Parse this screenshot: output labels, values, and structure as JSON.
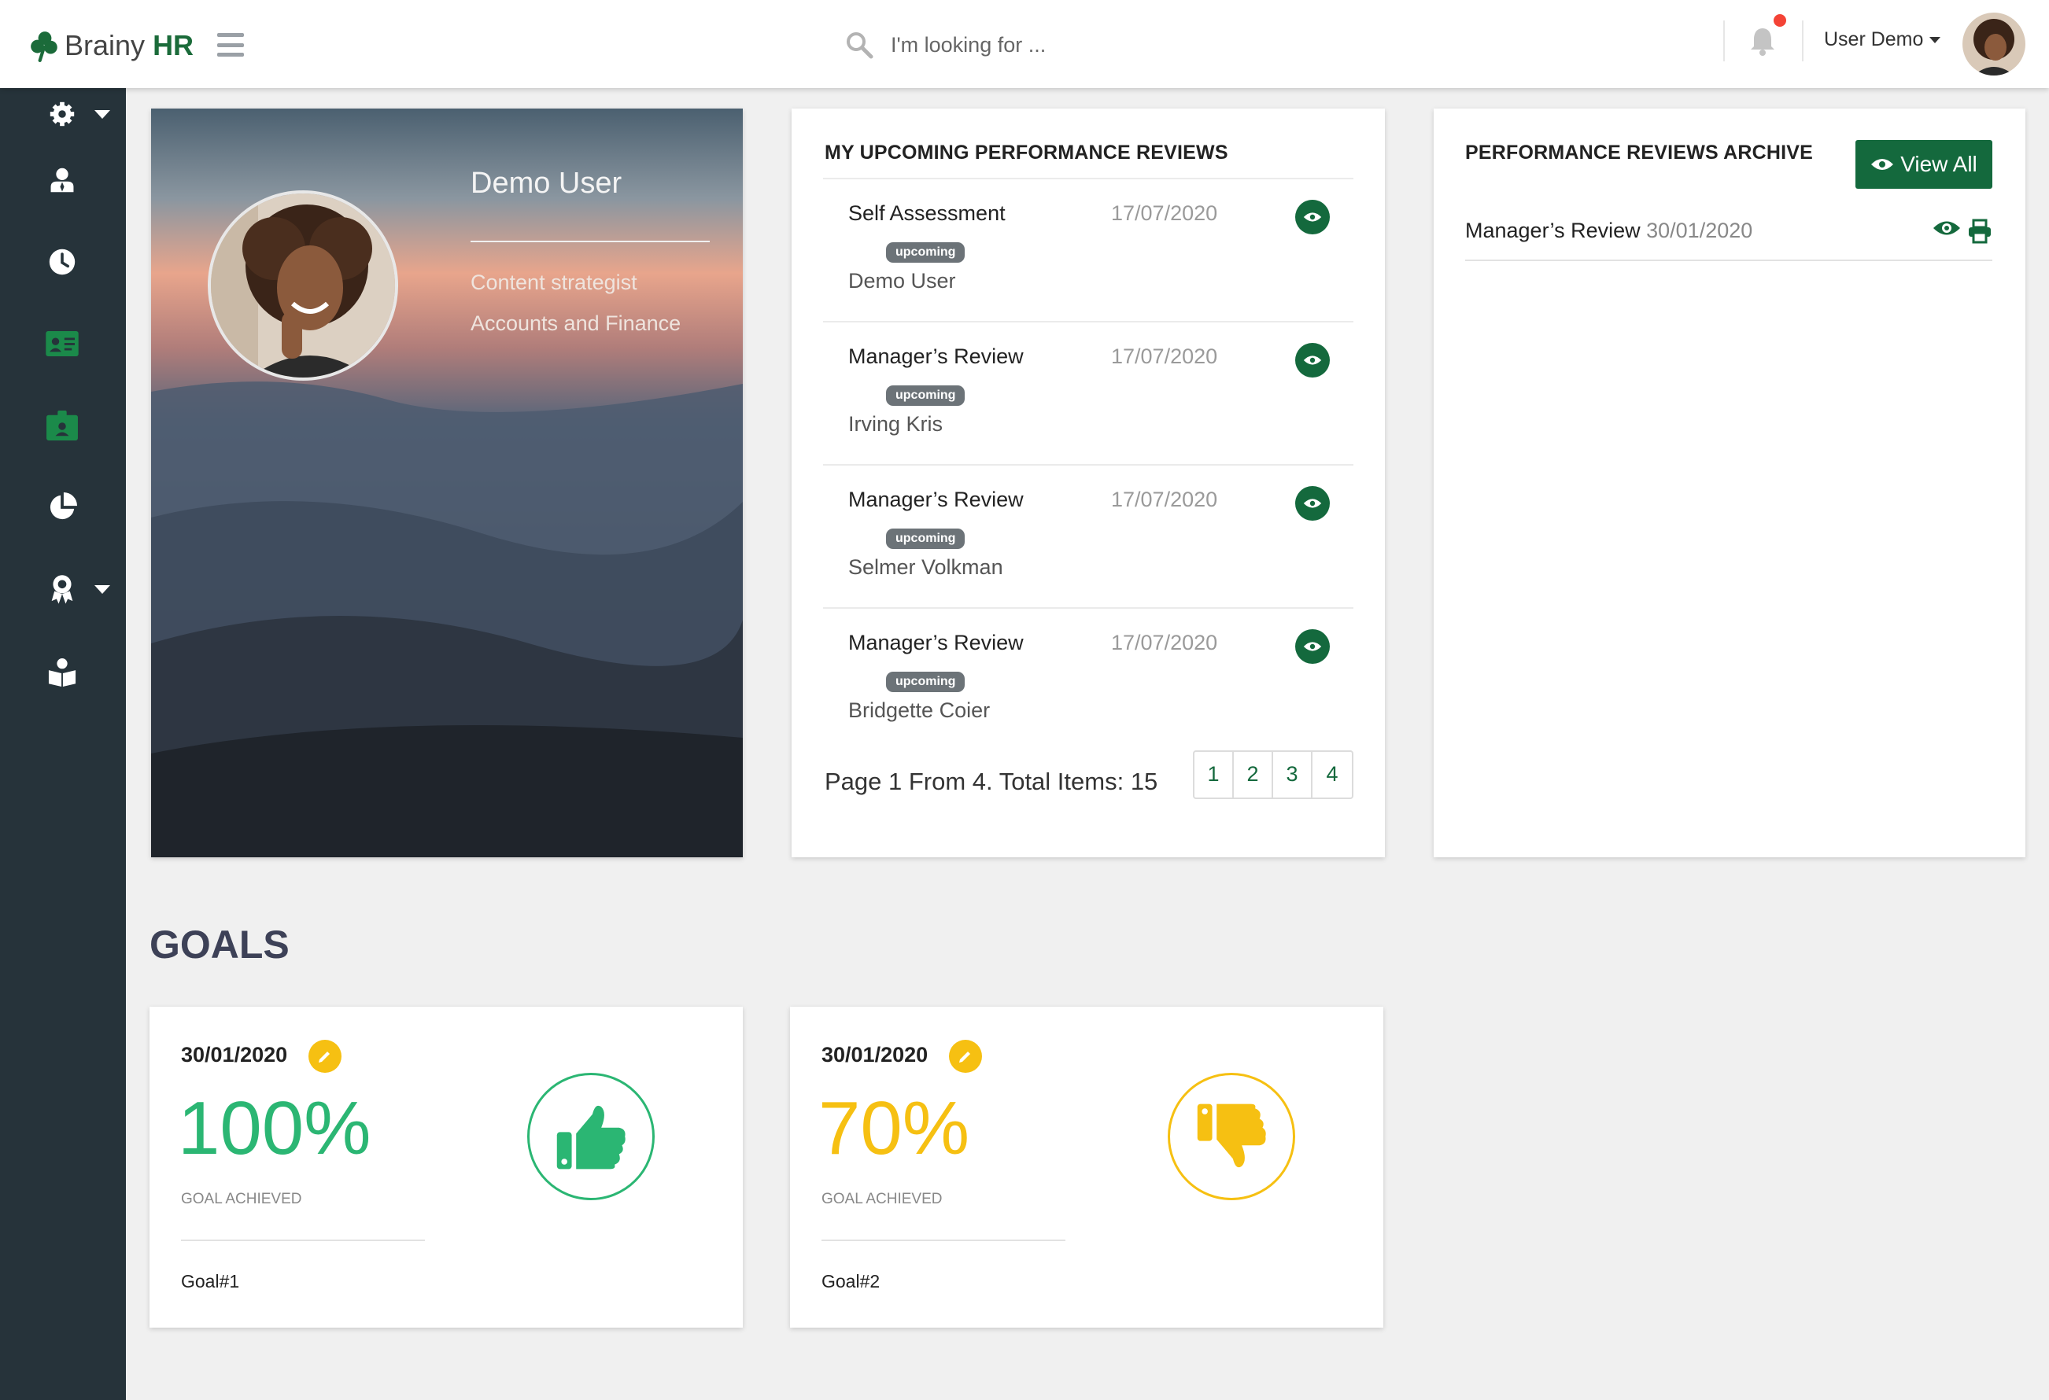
{
  "app": {
    "brand_prefix": "Brainy",
    "brand_suffix": "HR"
  },
  "search": {
    "placeholder": "I'm looking for ..."
  },
  "user": {
    "name": "User Demo"
  },
  "sidebar": {
    "items": [
      {
        "icon": "gear-icon",
        "dropdown": true,
        "color": "#ffffff"
      },
      {
        "icon": "user-icon",
        "color": "#ffffff"
      },
      {
        "icon": "clock-icon",
        "color": "#ffffff"
      },
      {
        "icon": "id-card-icon",
        "color": "#1b8a4a"
      },
      {
        "icon": "badge-icon",
        "color": "#1b8a4a"
      },
      {
        "icon": "pie-chart-icon",
        "color": "#ffffff"
      },
      {
        "icon": "award-icon",
        "dropdown": true,
        "color": "#ffffff"
      },
      {
        "icon": "book-reader-icon",
        "color": "#ffffff"
      }
    ]
  },
  "profile": {
    "name": "Demo User",
    "role": "Content strategist",
    "department": "Accounts and Finance"
  },
  "upcoming_reviews": {
    "title": "MY UPCOMING PERFORMANCE REVIEWS",
    "items": [
      {
        "type": "Self Assessment",
        "date": "17/07/2020",
        "status": "upcoming",
        "person": "Demo User"
      },
      {
        "type": "Manager’s Review",
        "date": "17/07/2020",
        "status": "upcoming",
        "person": "Irving Kris"
      },
      {
        "type": "Manager’s Review",
        "date": "17/07/2020",
        "status": "upcoming",
        "person": "Selmer Volkman"
      },
      {
        "type": "Manager’s Review",
        "date": "17/07/2020",
        "status": "upcoming",
        "person": "Bridgette Coier"
      }
    ],
    "pager_text": "Page 1 From 4. Total Items: 15",
    "pages": [
      "1",
      "2",
      "3",
      "4"
    ]
  },
  "archive": {
    "title": "PERFORMANCE REVIEWS ARCHIVE",
    "view_all_label": "View All",
    "items": [
      {
        "type": "Manager’s Review",
        "date": "30/01/2020"
      }
    ]
  },
  "goals": {
    "title": "GOALS",
    "items": [
      {
        "date": "30/01/2020",
        "percent": "100%",
        "label": "GOAL ACHIEVED",
        "name": "Goal#1",
        "color": "#2bb673",
        "icon": "thumbs-up-icon"
      },
      {
        "date": "30/01/2020",
        "percent": "70%",
        "label": "GOAL ACHIEVED",
        "name": "Goal#2",
        "color": "#f6c012",
        "icon": "thumbs-down-icon"
      }
    ]
  },
  "colors": {
    "primary": "#14693d",
    "sidebar_bg": "#26333a",
    "badge_bg": "#6c7378",
    "notification_dot": "#f44336"
  }
}
